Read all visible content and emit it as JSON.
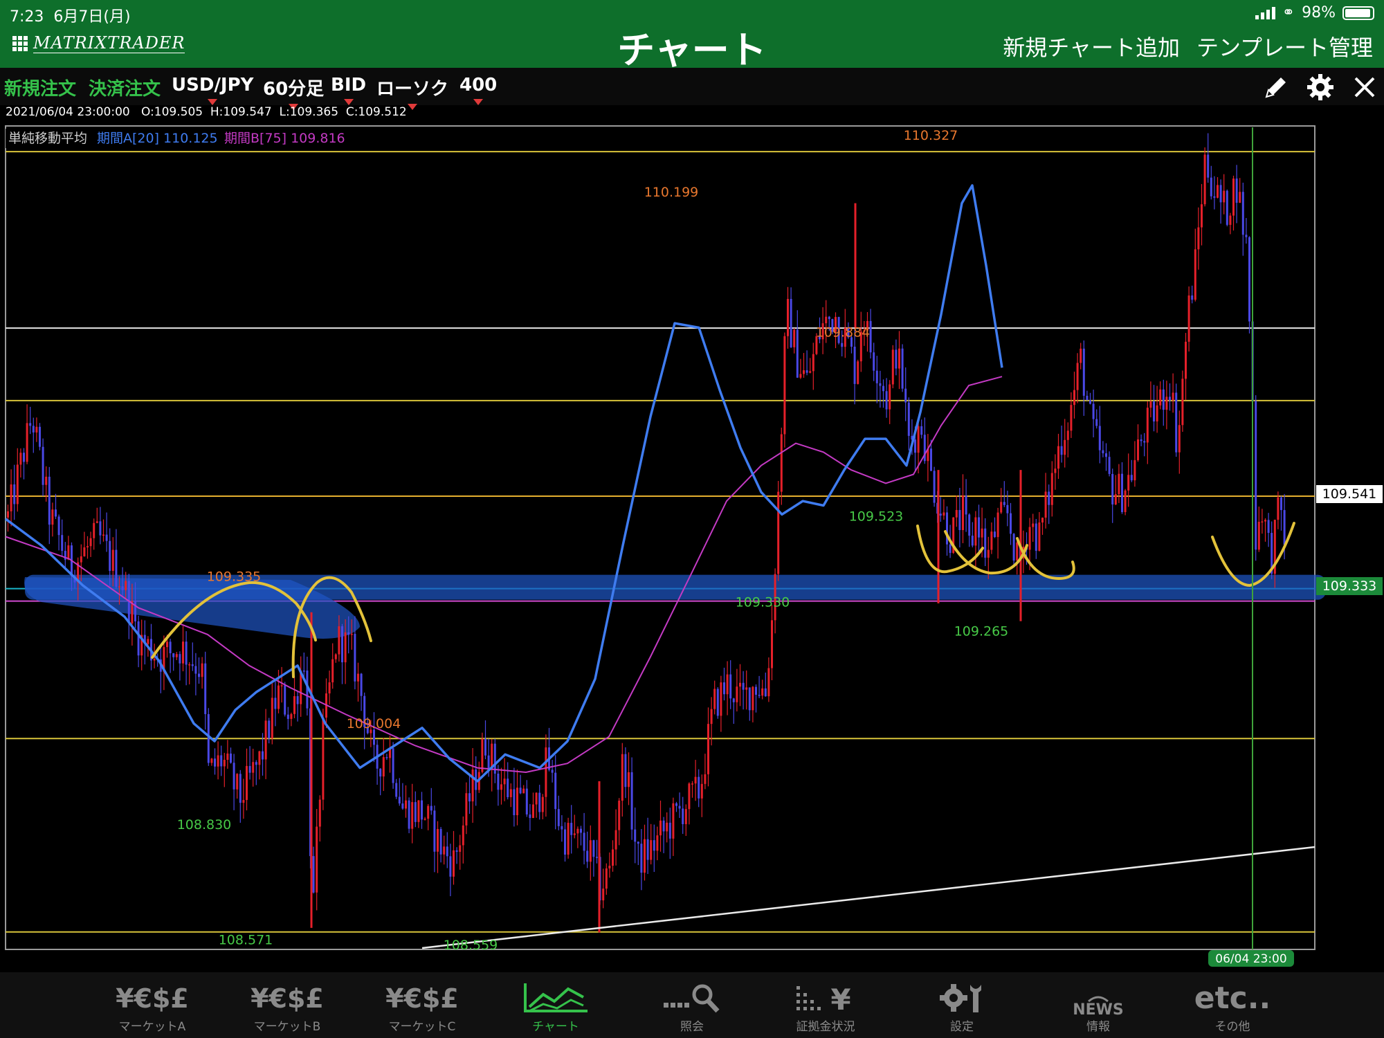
{
  "status": {
    "time": "7:23",
    "date": "6月7日(月)",
    "battery": "98%"
  },
  "header": {
    "logo": "MATRIXTRADER",
    "title": "チャート",
    "add_chart": "新規チャート追加",
    "template_manage": "テンプレート管理"
  },
  "toolbar": {
    "new_order": "新規注文",
    "close_order": "決済注文",
    "symbol": "USD/JPY",
    "timeframe": "60分足",
    "price_type": "BID",
    "chart_type": "ローソク",
    "bars": "400"
  },
  "ohlc": {
    "datetime": "2021/06/04 23:00:00",
    "open": "O:109.505",
    "high": "H:109.547",
    "low": "L:109.365",
    "close": "C:109.512"
  },
  "indicator": {
    "name": "単純移動平均",
    "ma_a": "期間A[20] 110.125",
    "ma_b": "期間B[75] 109.816",
    "color_a": "#3f7cf0",
    "color_b": "#c43ac4"
  },
  "chart_data": {
    "type": "line",
    "symbol": "USD/JPY",
    "ylim": [
      108.53,
      110.38
    ],
    "price_labels": [
      {
        "text": "110.327",
        "kind": "high",
        "price": 110.327,
        "bar": 1345
      },
      {
        "text": "110.199",
        "kind": "high",
        "price": 110.199,
        "bar": 970
      },
      {
        "text": "109.884",
        "kind": "high",
        "price": 109.884,
        "bar": 1218
      },
      {
        "text": "109.335",
        "kind": "high",
        "price": 109.335,
        "bar": 338
      },
      {
        "text": "109.004",
        "kind": "high",
        "price": 109.004,
        "bar": 540
      },
      {
        "text": "109.523",
        "kind": "low",
        "price": 109.523,
        "bar": 1266
      },
      {
        "text": "109.330",
        "kind": "low",
        "price": 109.33,
        "bar": 1102
      },
      {
        "text": "109.265",
        "kind": "low",
        "price": 109.265,
        "bar": 1418
      },
      {
        "text": "108.830",
        "kind": "low",
        "price": 108.83,
        "bar": 295
      },
      {
        "text": "108.571",
        "kind": "low",
        "price": 108.571,
        "bar": 355
      },
      {
        "text": "108.559",
        "kind": "low",
        "price": 108.559,
        "bar": 680
      }
    ],
    "horizontal_lines": [
      {
        "price": 110.316,
        "color": "#d8c43a"
      },
      {
        "price": 109.919,
        "color": "#e6e6e6"
      },
      {
        "price": 109.756,
        "color": "#d8c43a"
      },
      {
        "price": 109.541,
        "color": "#e6b030"
      },
      {
        "price": 109.333,
        "color": "#19b6c9"
      },
      {
        "price": 109.305,
        "color": "#d14ad1"
      },
      {
        "price": 108.996,
        "color": "#d8c43a"
      },
      {
        "price": 108.561,
        "color": "#d8c43a"
      }
    ],
    "current_price_tag": "109.541",
    "line_price_tag": "109.333",
    "cursor_time_tag": "06/04 23:00",
    "ma_a_points": [
      [
        8,
        109.49
      ],
      [
        60,
        109.43
      ],
      [
        120,
        109.34
      ],
      [
        180,
        109.27
      ],
      [
        230,
        109.17
      ],
      [
        280,
        109.03
      ],
      [
        310,
        108.99
      ],
      [
        340,
        109.06
      ],
      [
        370,
        109.1
      ],
      [
        410,
        109.14
      ],
      [
        430,
        109.16
      ],
      [
        470,
        109.03
      ],
      [
        520,
        108.93
      ],
      [
        570,
        108.98
      ],
      [
        610,
        109.02
      ],
      [
        650,
        108.95
      ],
      [
        690,
        108.9
      ],
      [
        730,
        108.96
      ],
      [
        780,
        108.93
      ],
      [
        820,
        108.99
      ],
      [
        860,
        109.13
      ],
      [
        900,
        109.43
      ],
      [
        940,
        109.72
      ],
      [
        975,
        109.93
      ],
      [
        1010,
        109.92
      ],
      [
        1040,
        109.78
      ],
      [
        1070,
        109.65
      ],
      [
        1100,
        109.55
      ],
      [
        1130,
        109.5
      ],
      [
        1160,
        109.53
      ],
      [
        1190,
        109.52
      ],
      [
        1220,
        109.6
      ],
      [
        1250,
        109.67
      ],
      [
        1280,
        109.67
      ],
      [
        1310,
        109.61
      ],
      [
        1330,
        109.73
      ],
      [
        1360,
        109.95
      ],
      [
        1390,
        110.2
      ],
      [
        1405,
        110.24
      ],
      [
        1425,
        110.06
      ],
      [
        1448,
        109.83
      ]
    ],
    "ma_b_points": [
      [
        8,
        109.45
      ],
      [
        100,
        109.4
      ],
      [
        200,
        109.29
      ],
      [
        300,
        109.23
      ],
      [
        360,
        109.16
      ],
      [
        420,
        109.11
      ],
      [
        500,
        109.05
      ],
      [
        600,
        108.98
      ],
      [
        690,
        108.93
      ],
      [
        760,
        108.92
      ],
      [
        820,
        108.94
      ],
      [
        880,
        109.0
      ],
      [
        940,
        109.18
      ],
      [
        1000,
        109.37
      ],
      [
        1050,
        109.53
      ],
      [
        1100,
        109.61
      ],
      [
        1150,
        109.66
      ],
      [
        1190,
        109.64
      ],
      [
        1230,
        109.6
      ],
      [
        1280,
        109.57
      ],
      [
        1320,
        109.59
      ],
      [
        1360,
        109.7
      ],
      [
        1400,
        109.79
      ],
      [
        1448,
        109.81
      ]
    ]
  },
  "nav": [
    {
      "icon": "¥€$£",
      "label": "マーケットA"
    },
    {
      "icon": "¥€$£",
      "label": "マーケットB"
    },
    {
      "icon": "¥€$£",
      "label": "マーケットC"
    },
    {
      "icon": "chart",
      "label": "チャート"
    },
    {
      "icon": "search",
      "label": "照会"
    },
    {
      "icon": "margin",
      "label": "証拠金状況"
    },
    {
      "icon": "gear",
      "label": "設定"
    },
    {
      "icon": "NEWS",
      "label": "情報"
    },
    {
      "icon": "etc..",
      "label": "その他"
    }
  ]
}
